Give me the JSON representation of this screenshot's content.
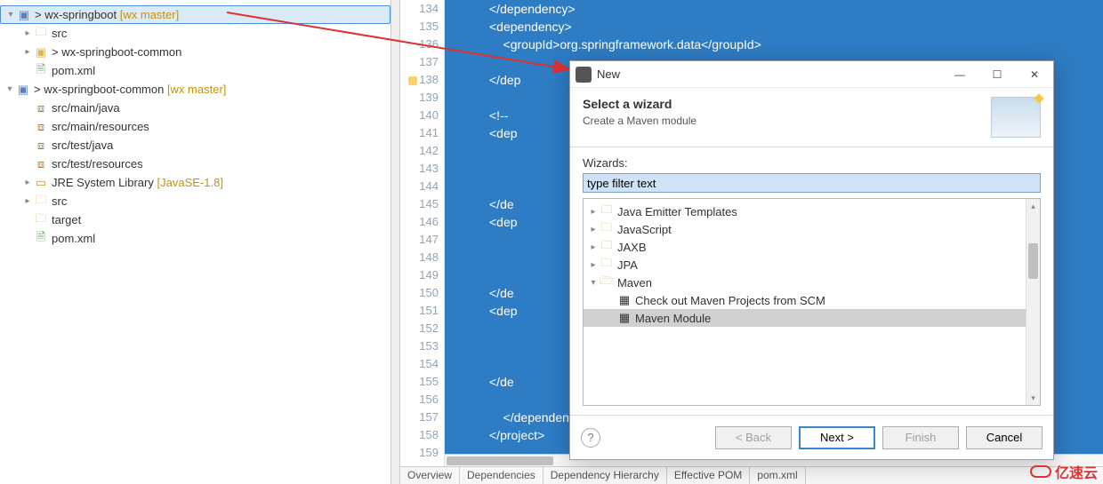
{
  "tree": {
    "proj1": {
      "name": "> wx-springboot",
      "branch": "[wx master]"
    },
    "p1_src": "src",
    "p1_common": "> wx-springboot-common",
    "p1_pom": "pom.xml",
    "proj2": {
      "name": "> wx-springboot-common",
      "branch": "[wx master]"
    },
    "p2_mainjava": "src/main/java",
    "p2_mainres": "src/main/resources",
    "p2_testjava": "src/test/java",
    "p2_testres": "src/test/resources",
    "p2_jre": {
      "label": "JRE System Library",
      "ver": "[JavaSE-1.8]"
    },
    "p2_src": "src",
    "p2_target": "target",
    "p2_pom": "pom.xml"
  },
  "gutter": [
    "134",
    "135",
    "136",
    "137",
    "138",
    "139",
    "140",
    "141",
    "142",
    "143",
    "144",
    "145",
    "146",
    "147",
    "148",
    "149",
    "150",
    "151",
    "152",
    "153",
    "154",
    "155",
    "156",
    "157",
    "158",
    "159"
  ],
  "code": {
    "l0": "</dependency>",
    "l1": "<dependency>",
    "l2": "    <groupId>org.springframework.data</groupId>",
    "l3": "",
    "l4": "</dep",
    "l5": "",
    "l6": "<!--",
    "l7": "<dep",
    "l8": "",
    "l9": "",
    "l10": "",
    "l11": "</de",
    "l12": "<dep",
    "l13": "",
    "l14": "",
    "l15": "",
    "l16": "</de",
    "l17": "<dep",
    "l18": "",
    "l19": "",
    "l20": "",
    "l21": "</de",
    "l22": "",
    "l23": "    </dependen",
    "l24": "</project>"
  },
  "bottom_tabs": [
    "Overview",
    "Dependencies",
    "Dependency Hierarchy",
    "Effective POM",
    "pom.xml"
  ],
  "dialog": {
    "title": "New",
    "header_title": "Select a wizard",
    "header_desc": "Create a Maven module",
    "wizards_label": "Wizards:",
    "filter_placeholder": "type filter text",
    "nodes": {
      "jet": "Java Emitter Templates",
      "js": "JavaScript",
      "jaxb": "JAXB",
      "jpa": "JPA",
      "maven": "Maven",
      "m_scm": "Check out Maven Projects from SCM",
      "m_module": "Maven Module"
    },
    "buttons": {
      "back": "< Back",
      "next": "Next >",
      "finish": "Finish",
      "cancel": "Cancel"
    }
  },
  "watermark": "亿速云"
}
